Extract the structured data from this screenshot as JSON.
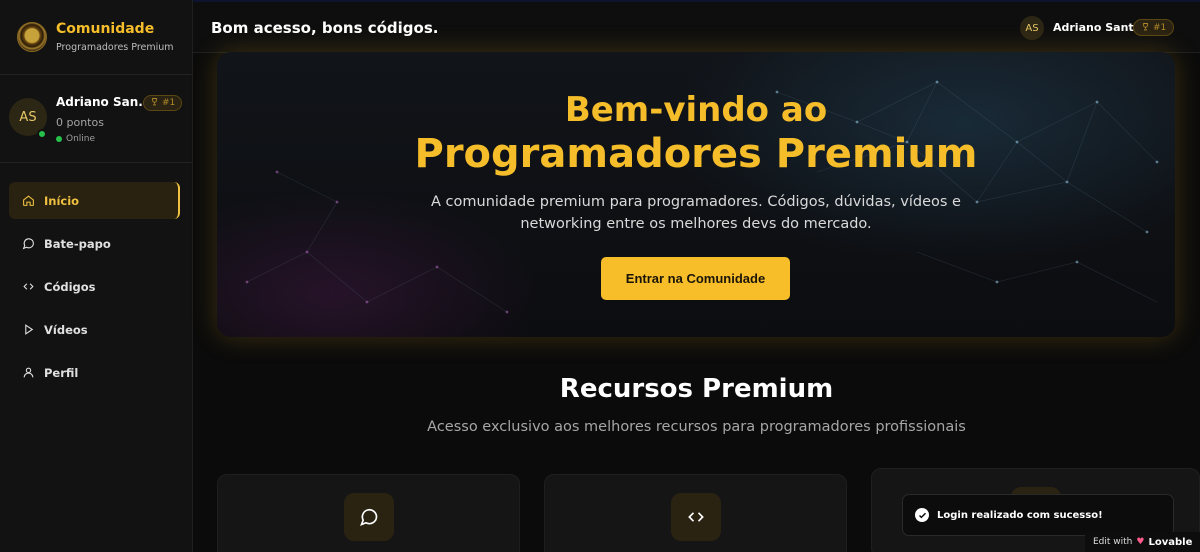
{
  "brand": {
    "title": "Comunidade",
    "subtitle": "Programadores Premium"
  },
  "user": {
    "initials": "AS",
    "name": "Adriano San...",
    "rank": "#1",
    "points": "0 pontos",
    "status": "Online"
  },
  "nav": {
    "items": [
      {
        "label": "Início",
        "icon": "home-icon",
        "active": true
      },
      {
        "label": "Bate-papo",
        "icon": "chat-icon",
        "active": false
      },
      {
        "label": "Códigos",
        "icon": "code-icon",
        "active": false
      },
      {
        "label": "Vídeos",
        "icon": "play-icon",
        "active": false
      },
      {
        "label": "Perfil",
        "icon": "user-icon",
        "active": false
      }
    ]
  },
  "header": {
    "greeting": "Bom acesso, bons códigos.",
    "initials": "AS",
    "user_name": "Adriano Santos",
    "rank": "#1"
  },
  "hero": {
    "title_line1": "Bem-vindo ao",
    "title_line2": "Programadores Premium",
    "description": "A comunidade premium para programadores. Códigos, dúvidas, vídeos e networking entre os melhores devs do mercado.",
    "cta": "Entrar na Comunidade"
  },
  "section": {
    "title": "Recursos Premium",
    "subtitle": "Acesso exclusivo aos melhores recursos para programadores profissionais"
  },
  "cards": [
    {
      "icon": "chat-icon"
    },
    {
      "icon": "code-icon"
    },
    {
      "icon": "feature-icon"
    }
  ],
  "toast": {
    "message": "Login realizado com sucesso!"
  },
  "badge": {
    "prefix": "Edit with",
    "brand": "Lovable"
  },
  "colors": {
    "accent": "#f5bd2a",
    "background": "#0b0b0b",
    "sidebar": "#121212",
    "online": "#27c24c"
  }
}
